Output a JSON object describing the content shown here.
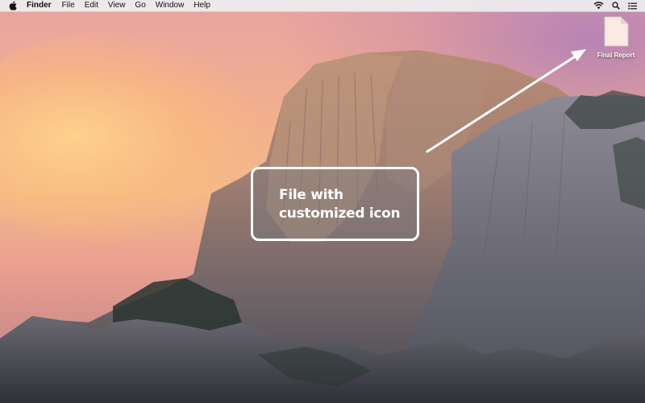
{
  "menubar": {
    "app_name": "Finder",
    "items": [
      "File",
      "Edit",
      "View",
      "Go",
      "Window",
      "Help"
    ],
    "icons": {
      "apple": "apple-logo-icon",
      "status": [
        "wifi-icon",
        "search-icon",
        "list-icon"
      ]
    }
  },
  "desktop": {
    "wallpaper": "Yosemite El Capitan rock face at dusk",
    "file": {
      "name": "Final Report",
      "icon": "document-icon"
    }
  },
  "annotation": {
    "text_line1": "File with",
    "text_line2": "customized icon"
  },
  "colors": {
    "menubar_bg": "#eeeeee",
    "callout_border": "#ffffff",
    "arrow": "#ffffff"
  }
}
